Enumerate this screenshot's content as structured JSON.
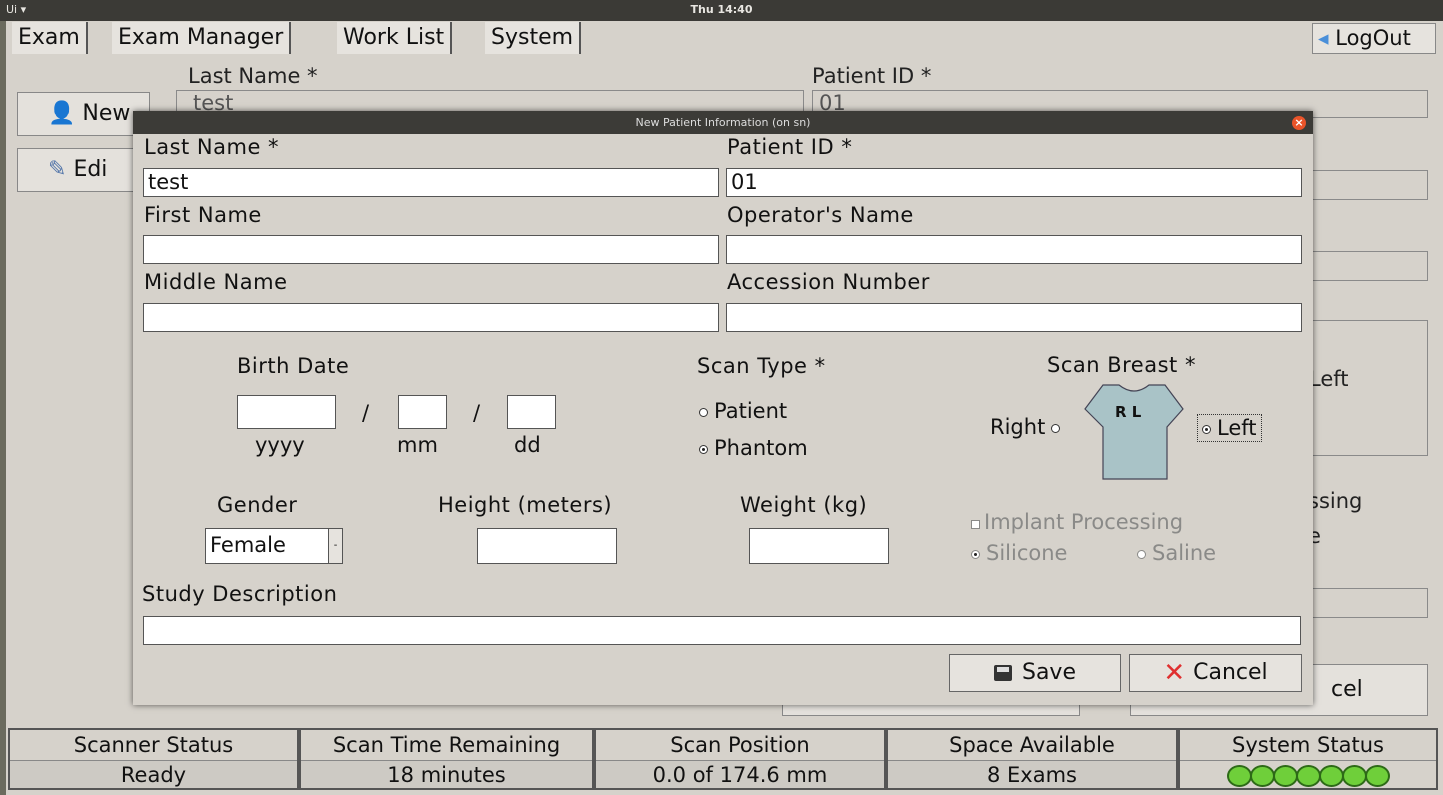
{
  "topbar": {
    "app_label": "Ui ▾",
    "clock": "Thu 14:40"
  },
  "main": {
    "tabs": [
      "Exam",
      "Exam Manager",
      "Work List",
      "System"
    ],
    "logout_label": "LogOut",
    "last_name_label": "Last Name *",
    "last_name_value": "test",
    "patient_id_label": "Patient ID *",
    "patient_id_value": "01",
    "new_button": "New",
    "edit_button": "Edi",
    "left_text": "Left",
    "processing_text": "ssing",
    "e_text": "e",
    "cancel_text": "cel"
  },
  "dialog": {
    "title": "New Patient Information (on sn)",
    "last_name_label": "Last Name *",
    "last_name_value": "test",
    "patient_id_label": "Patient ID *",
    "patient_id_value": "01",
    "first_name_label": "First Name",
    "first_name_value": "",
    "operator_label": "Operator's Name",
    "operator_value": "",
    "middle_name_label": "Middle Name",
    "middle_name_value": "",
    "accession_label": "Accession Number",
    "accession_value": "",
    "birth_date_label": "Birth Date",
    "yyyy_label": "yyyy",
    "mm_label": "mm",
    "dd_label": "dd",
    "slash": "/",
    "scan_type_label": "Scan Type *",
    "scan_type_options": [
      "Patient",
      "Phantom"
    ],
    "scan_type_selected": "Phantom",
    "scan_breast_label": "Scan Breast *",
    "right_label": "Right",
    "left_label": "Left",
    "torso_text": "R L",
    "gender_label": "Gender",
    "gender_value": "Female",
    "height_label": "Height (meters)",
    "weight_label": "Weight (kg)",
    "implant_label": "Implant Processing",
    "silicone_label": "Silicone",
    "saline_label": "Saline",
    "study_desc_label": "Study Description",
    "save_label": "Save",
    "cancel_label": "Cancel"
  },
  "status": [
    {
      "header": "Scanner Status",
      "value": "Ready"
    },
    {
      "header": "Scan Time Remaining",
      "value": "18 minutes"
    },
    {
      "header": "Scan Position",
      "value": "0.0 of 174.6 mm"
    },
    {
      "header": "Space Available",
      "value": "8 Exams"
    },
    {
      "header": "System Status",
      "leds": 7
    }
  ],
  "colors": {
    "led_green": "#6fcf3a",
    "close_orange": "#e9542a",
    "torso": "#a9c3c7"
  }
}
